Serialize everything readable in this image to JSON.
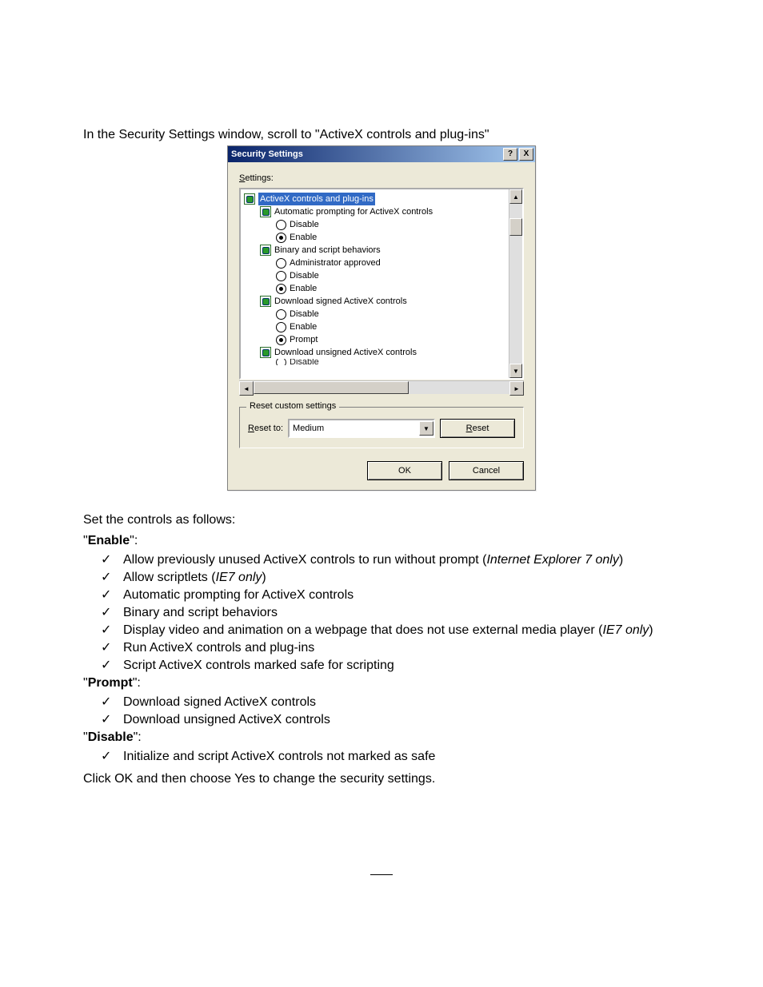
{
  "doc": {
    "intro": "In the Security Settings window, scroll to \"ActiveX controls and plug-ins\"",
    "set_controls": "Set the controls as follows:",
    "enable_heading": "Enable",
    "enable_items_plain": [
      "Automatic prompting for ActiveX controls",
      "Binary and script behaviors",
      "Run ActiveX controls and plug-ins",
      "Script ActiveX controls marked safe for scripting"
    ],
    "enable_item_1_a": "Allow previously unused ActiveX controls to run without prompt (",
    "enable_item_1_b_ital": "Internet Explorer 7 only",
    "enable_item_1_c": ")",
    "enable_item_2_a": "Allow scriptlets (",
    "enable_item_2_b_ital": "IE7 only",
    "enable_item_2_c": ")",
    "enable_item_5_a": "Display video and animation on a webpage that does not use external media player (",
    "enable_item_5_b_ital": "IE7 only",
    "enable_item_5_c": ")",
    "prompt_heading": "Prompt",
    "prompt_items": [
      "Download signed ActiveX controls",
      "Download unsigned ActiveX controls"
    ],
    "disable_heading": "Disable",
    "disable_items": [
      "Initialize and script ActiveX controls not marked as safe"
    ],
    "outro": "Click OK and then choose Yes to change the security settings."
  },
  "dialog": {
    "title": "Security Settings",
    "help_glyph": "?",
    "close_glyph": "X",
    "settings_label_pre": "S",
    "settings_label_post": "ettings:",
    "tree": {
      "root": "ActiveX controls and plug-ins",
      "grp1": {
        "label": "Automatic prompting for ActiveX controls",
        "opt_disable": "Disable",
        "opt_enable": "Enable"
      },
      "grp2": {
        "label": "Binary and script behaviors",
        "opt_admin": "Administrator approved",
        "opt_disable": "Disable",
        "opt_enable": "Enable"
      },
      "grp3": {
        "label": "Download signed ActiveX controls",
        "opt_disable": "Disable",
        "opt_enable": "Enable",
        "opt_prompt": "Prompt"
      },
      "grp4": {
        "label": "Download unsigned ActiveX controls",
        "opt_disable_partial": "Disable"
      }
    },
    "reset_legend": "Reset custom settings",
    "reset_to_pre": "R",
    "reset_to_post": "eset to:",
    "reset_value": "Medium",
    "reset_btn_pre": "R",
    "reset_btn_post": "eset",
    "ok": "OK",
    "cancel": "Cancel"
  }
}
